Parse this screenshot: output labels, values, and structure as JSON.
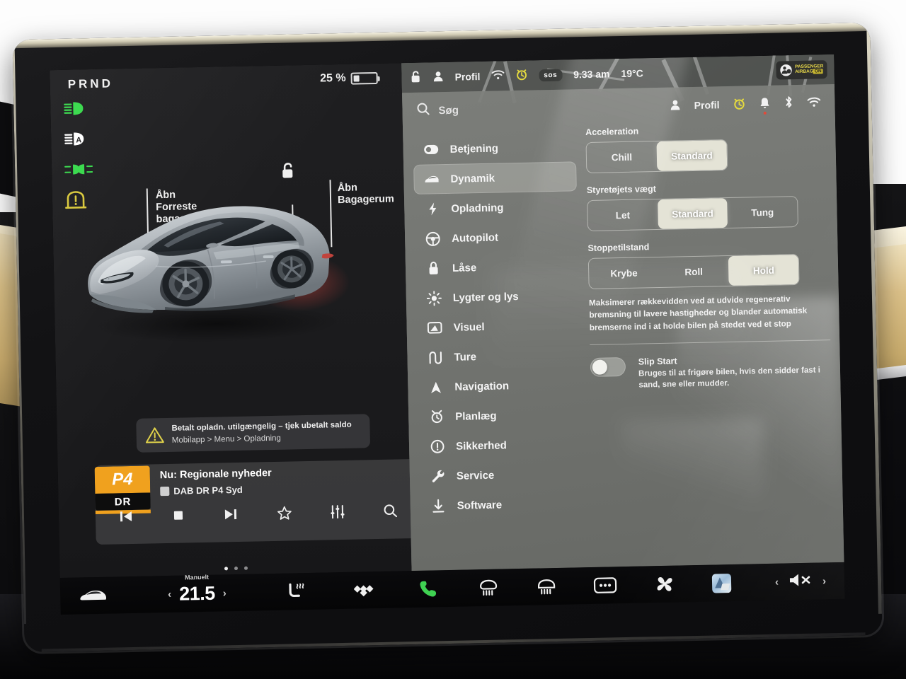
{
  "screen": {
    "left_pane": {
      "gear_indicator": "PRND",
      "battery_percent": "25 %",
      "battery_level": 25,
      "telltales": [
        {
          "name": "low-beam-headlight-icon",
          "color": "#36d94a",
          "label": "Low beam headlights"
        },
        {
          "name": "auto-high-beam-icon",
          "color": "#ffffff",
          "label": "Auto high beam"
        },
        {
          "name": "fog-lights-icon",
          "color": "#36d94a",
          "label": "Fog lights"
        },
        {
          "name": "tire-pressure-warning-icon",
          "color": "#d9c83a",
          "label": "Tire pressure"
        }
      ],
      "callouts": [
        {
          "name": "open-front-trunk",
          "line1": "Åbn",
          "line2": "Forreste",
          "line3": "bagagerum"
        },
        {
          "name": "open-trunk",
          "line1": "Åbn",
          "line2": "Bagagerum",
          "line3": ""
        }
      ],
      "notification": {
        "title": "Betalt opladn. utilgængelig – tjek ubetalt saldo",
        "subtitle": "Mobilapp > Menu > Opladning"
      },
      "media": {
        "station_badge_top": "P4",
        "station_badge_bottom": "DR",
        "now_playing": "Nu: Regionale nyheder",
        "source": "DAB DR P4 Syd",
        "controls": [
          "previous-icon",
          "stop-icon",
          "next-icon",
          "favorite-star-icon",
          "equalizer-icon",
          "search-icon"
        ]
      }
    },
    "top_bar": {
      "lock_label": "lock-icon",
      "profile": "Profil",
      "wifi": "wifi-icon",
      "alarm": "alarm-clock-icon",
      "sos": "sos",
      "time": "9.33 am",
      "temperature": "19°C",
      "airbag_badge": {
        "line1": "PASSENGER",
        "line2": "AIRBAG",
        "state": "ON"
      }
    },
    "settings": {
      "search_placeholder": "Søg",
      "status_right": {
        "profile": "Profil",
        "icons": [
          "alarm-clock-icon",
          "notification-bell-icon",
          "bluetooth-icon",
          "wifi-icon"
        ]
      },
      "nav_items": [
        {
          "label": "Betjening",
          "icon": "toggle-switch-icon",
          "active": false
        },
        {
          "label": "Dynamik",
          "icon": "car-icon",
          "active": true
        },
        {
          "label": "Opladning",
          "icon": "lightning-bolt-icon",
          "active": false
        },
        {
          "label": "Autopilot",
          "icon": "steering-wheel-icon",
          "active": false
        },
        {
          "label": "Låse",
          "icon": "padlock-icon",
          "active": false
        },
        {
          "label": "Lygter og lys",
          "icon": "sun-brightness-icon",
          "active": false
        },
        {
          "label": "Visuel",
          "icon": "display-icon",
          "active": false
        },
        {
          "label": "Ture",
          "icon": "trips-icon",
          "active": false
        },
        {
          "label": "Navigation",
          "icon": "navigation-arrow-icon",
          "active": false
        },
        {
          "label": "Planlæg",
          "icon": "schedule-clock-icon",
          "active": false
        },
        {
          "label": "Sikkerhed",
          "icon": "info-circle-icon",
          "active": false
        },
        {
          "label": "Service",
          "icon": "wrench-icon",
          "active": false
        },
        {
          "label": "Software",
          "icon": "download-arrow-icon",
          "active": false
        }
      ],
      "groups": [
        {
          "title": "Acceleration",
          "name": "acceleration",
          "options": [
            {
              "label": "Chill",
              "selected": false
            },
            {
              "label": "Standard",
              "selected": true
            }
          ]
        },
        {
          "title": "Styretøjets vægt",
          "name": "steering-weight",
          "options": [
            {
              "label": "Let",
              "selected": false
            },
            {
              "label": "Standard",
              "selected": true
            },
            {
              "label": "Tung",
              "selected": false
            }
          ]
        },
        {
          "title": "Stoppetilstand",
          "name": "stopping-mode",
          "options": [
            {
              "label": "Krybe",
              "selected": false
            },
            {
              "label": "Roll",
              "selected": false
            },
            {
              "label": "Hold",
              "selected": true
            }
          ]
        }
      ],
      "stopping_mode_description": "Maksimerer rækkevidden ved at udvide regenerativ bremsning til lavere hastigheder og blander automatisk bremserne ind i at holde bilen på stedet ved et stop",
      "slip_start": {
        "title": "Slip Start",
        "description": "Bruges til at frigøre bilen, hvis den sidder fast i sand, sne eller mudder.",
        "enabled": false
      }
    },
    "taskbar": {
      "car_icon": "car-icon",
      "climate": {
        "mode": "Manuelt",
        "temperature": "21.5",
        "prev": "‹",
        "next": "›"
      },
      "icons": [
        "seat-heater-icon",
        "tidal-logo-icon",
        "phone-icon",
        "rear-defrost-icon",
        "front-defrost-icon",
        "more-options-icon",
        "fan-icon",
        "app-launcher-icon"
      ],
      "volume": {
        "prev": "‹",
        "mute": "muted-volume-icon",
        "next": "›"
      }
    }
  },
  "colors": {
    "accent_green": "#36d94a",
    "warning_yellow": "#d9c83a",
    "brand_orange": "#f0a11e",
    "selected_button": "#e4e3d6",
    "notification_red": "#e04a3a"
  }
}
